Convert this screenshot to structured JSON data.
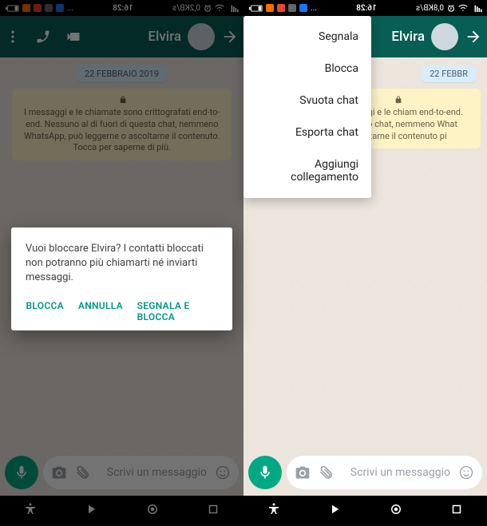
{
  "status": {
    "time": "16:28",
    "net_left": "0,8KB/s",
    "net_right": "0,2KB/s"
  },
  "contact": {
    "name": "Elvira"
  },
  "chat": {
    "date_label": "22 FEBBRAIO 2019",
    "date_label_partial": "22 FEBBR",
    "encryption_full": "I messaggi e le chiamate sono crittografati end-to-end. Nessuno al di fuori di questa chat, nemmeno WhatsApp, può leggerne o ascoltarne il contenuto. Tocca per saperne di più.",
    "encryption_partial": "I messaggi e le chiam\nend-to-end. Nessuno\nchat, nemmeno What\nascoltarne il contenuto\npi"
  },
  "composer": {
    "placeholder": "Scrivi un messaggio"
  },
  "menu": {
    "items": [
      {
        "label": "Segnala"
      },
      {
        "label": "Blocca"
      },
      {
        "label": "Svuota chat"
      },
      {
        "label": "Esporta chat"
      },
      {
        "label": "Aggiungi collegamento"
      }
    ]
  },
  "dialog": {
    "message": "Vuoi bloccare Elvira? I contatti bloccati non potranno più chiamarti né inviarti messaggi.",
    "actions": {
      "report_block": "SEGNALA E BLOCCA",
      "cancel": "ANNULLA",
      "block": "BLOCCA"
    }
  },
  "colors": {
    "header": "#075e54",
    "accent": "#00a884",
    "dialog_action": "#009688",
    "chat_bg": "#ece5dd"
  }
}
